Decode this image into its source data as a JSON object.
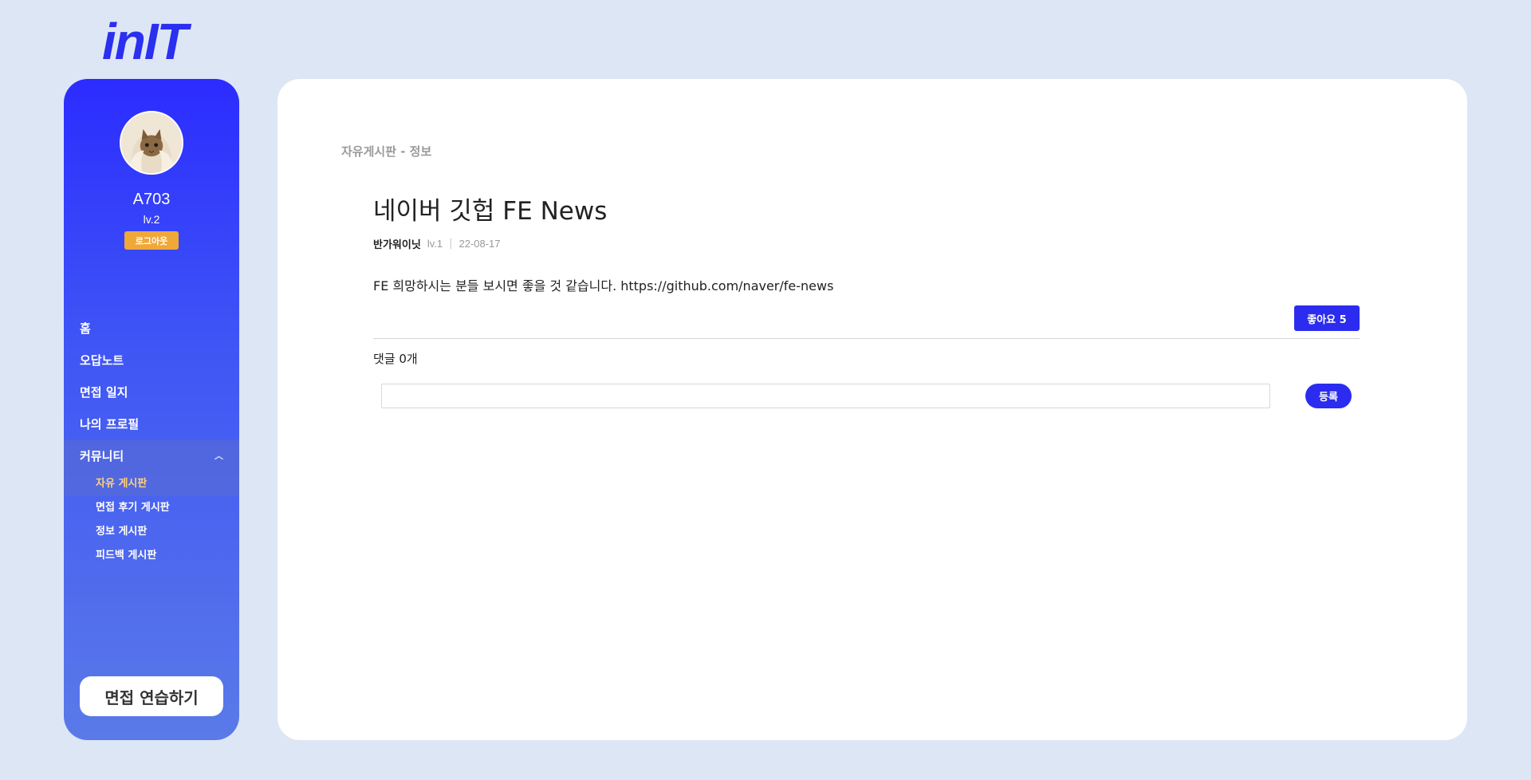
{
  "app": {
    "logo": "inIT"
  },
  "sidebar": {
    "username": "A703",
    "level": "lv.2",
    "logout_label": "로그아웃",
    "nav": [
      {
        "label": "홈"
      },
      {
        "label": "오답노트"
      },
      {
        "label": "면접 일지"
      },
      {
        "label": "나의 프로필"
      },
      {
        "label": "커뮤니티",
        "expanded": true
      }
    ],
    "community_sub": [
      {
        "label": "자유 게시판",
        "active": true
      },
      {
        "label": "면접 후기 게시판"
      },
      {
        "label": "정보 게시판"
      },
      {
        "label": "피드백 게시판"
      }
    ],
    "practice_label": "면접 연습하기"
  },
  "post": {
    "breadcrumb": "자유게시판 - 정보",
    "title": "네이버 깃헙 FE News",
    "author": "반가워이닛",
    "author_level": "lv.1",
    "date": "22-08-17",
    "body": "FE 희망하시는 분들 보시면 좋을 것 같습니다. https://github.com/naver/fe-news",
    "like_label": "좋아요 5"
  },
  "comments": {
    "count_label": "댓글 0개",
    "input_value": "",
    "input_placeholder": "",
    "submit_label": "등록"
  },
  "colors": {
    "accent": "#2b2cf0",
    "logout": "#f0a838",
    "active_sub": "#ffd27a",
    "background": "#dde6f5"
  }
}
